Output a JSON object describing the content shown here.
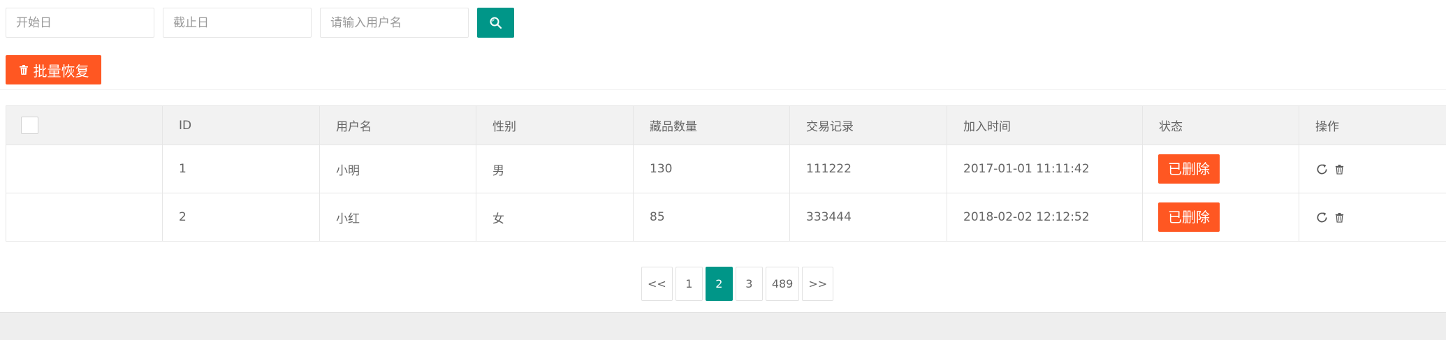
{
  "search": {
    "start_date_placeholder": "开始日",
    "end_date_placeholder": "截止日",
    "username_placeholder": "请输入用户名"
  },
  "toolbar": {
    "bulk_restore_label": "批量恢复"
  },
  "table": {
    "headers": [
      "ID",
      "用户名",
      "性别",
      "藏品数量",
      "交易记录",
      "加入时间",
      "状态",
      "操作"
    ],
    "rows": [
      {
        "id": "1",
        "username": "小明",
        "gender": "男",
        "collection_count": "130",
        "trade_record": "111222",
        "joined": "2017-01-01 11:11:42",
        "status": "已删除"
      },
      {
        "id": "2",
        "username": "小红",
        "gender": "女",
        "collection_count": "85",
        "trade_record": "333444",
        "joined": "2018-02-02 12:12:52",
        "status": "已删除"
      }
    ]
  },
  "pagination": {
    "prev": "<<",
    "pages": [
      "1",
      "2",
      "3",
      "489"
    ],
    "current": "2",
    "next": ">>"
  },
  "colors": {
    "primary": "#009688",
    "danger": "#ff5722"
  },
  "icons": {
    "search": "search-icon",
    "trash": "trash-icon",
    "restore": "refresh-icon"
  }
}
